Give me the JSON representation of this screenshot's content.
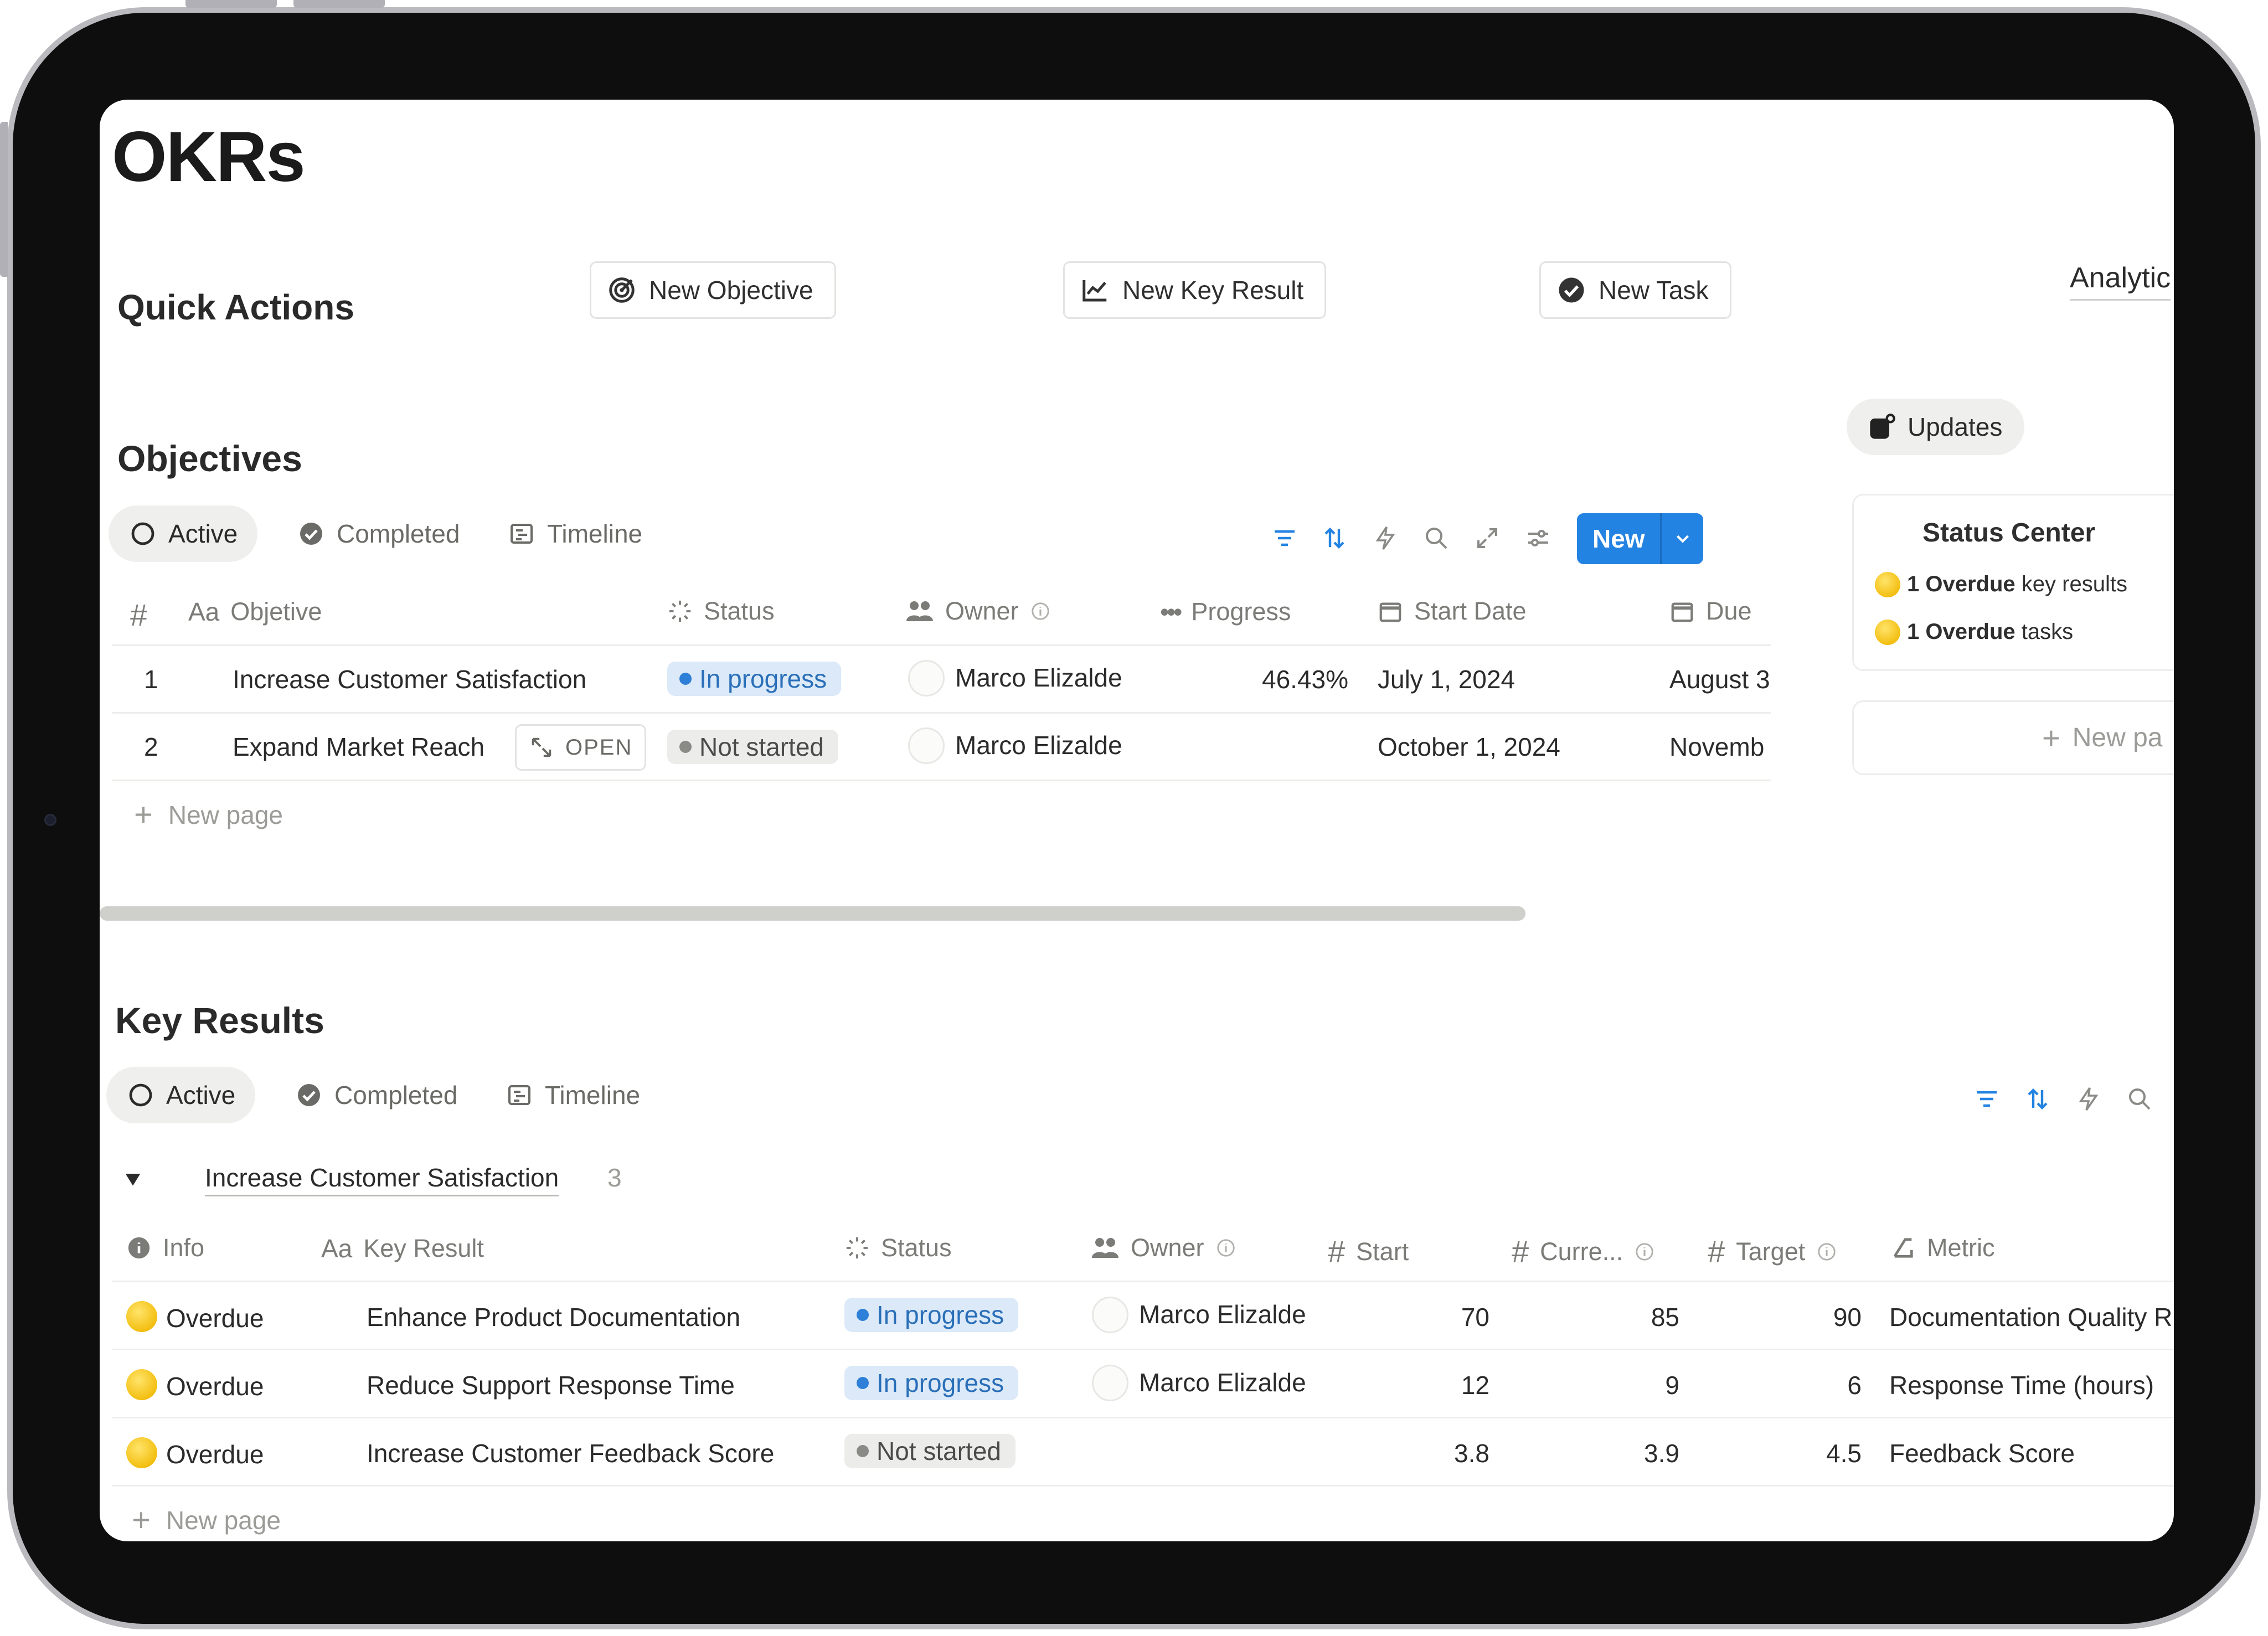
{
  "page": {
    "title": "OKRs"
  },
  "quick_actions": {
    "title": "Quick Actions",
    "new_objective": "New Objective",
    "new_key_result": "New Key Result",
    "new_task": "New Task",
    "analytics_tab": "Analytic"
  },
  "right_panel": {
    "updates_label": "Updates",
    "status_center": {
      "title": "Status Center",
      "items": [
        {
          "bold": "1 Overdue",
          "text": " key results"
        },
        {
          "bold": "1 Overdue",
          "text": " tasks"
        }
      ]
    },
    "new_page": "New pa"
  },
  "objectives": {
    "title": "Objectives",
    "tabs": [
      "Active",
      "Completed",
      "Timeline"
    ],
    "new_button": "New",
    "columns": {
      "number": "#",
      "objective": "Objetive",
      "status": "Status",
      "owner": "Owner",
      "progress": "Progress",
      "start_date": "Start Date",
      "due": "Due"
    },
    "rows": [
      {
        "num": "1",
        "name": "Increase Customer Satisfaction",
        "status": "In progress",
        "status_color": "blue",
        "owner": "Marco Elizalde",
        "progress": "46.43%",
        "progress_value": 0.4643,
        "start": "July 1, 2024",
        "due": "August 3"
      },
      {
        "num": "2",
        "name": "Expand Market Reach",
        "open_label": "OPEN",
        "status": "Not started",
        "status_color": "gray",
        "owner": "Marco Elizalde",
        "progress": "",
        "start": "October 1, 2024",
        "due": "Novemb"
      }
    ],
    "new_page": "New page"
  },
  "key_results": {
    "title": "Key Results",
    "tabs": [
      "Active",
      "Completed",
      "Timeline"
    ],
    "group": {
      "name": "Increase Customer Satisfaction",
      "count": "3"
    },
    "columns": {
      "info": "Info",
      "key_result": "Key Result",
      "status": "Status",
      "owner": "Owner",
      "start": "Start",
      "current": "Curre...",
      "target": "Target",
      "metric": "Metric"
    },
    "rows": [
      {
        "info": "Overdue",
        "name": "Enhance Product Documentation",
        "status": "In progress",
        "status_color": "blue",
        "owner": "Marco Elizalde",
        "start": "70",
        "current": "85",
        "target": "90",
        "metric": "Documentation Quality R"
      },
      {
        "info": "Overdue",
        "name": "Reduce Support Response Time",
        "status": "In progress",
        "status_color": "blue",
        "owner": "Marco Elizalde",
        "start": "12",
        "current": "9",
        "target": "6",
        "metric": "Response Time (hours)"
      },
      {
        "info": "Overdue",
        "name": "Increase Customer Feedback Score",
        "status": "Not started",
        "status_color": "gray",
        "owner": "",
        "start": "3.8",
        "current": "3.9",
        "target": "4.5",
        "metric": "Feedback Score"
      }
    ],
    "new_page": "New page"
  },
  "colors": {
    "accent": "#2383e2",
    "in_progress_bg": "#dbe9f8",
    "not_started_bg": "#ececea",
    "overdue": "#f3bf12"
  }
}
